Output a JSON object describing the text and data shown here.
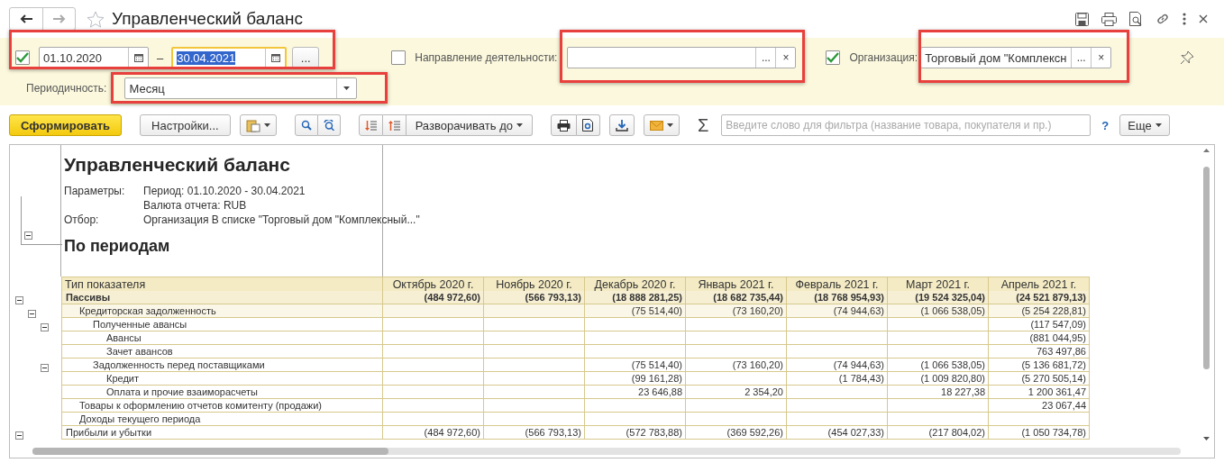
{
  "window": {
    "title": "Управленческий баланс"
  },
  "filters": {
    "period": {
      "checked": true,
      "from": {
        "value": "01.10.2020",
        "focused": false
      },
      "separator": "–",
      "to": {
        "value": "30.04.2021",
        "focused": true
      },
      "more_button": "..."
    },
    "direction": {
      "checked": false,
      "label": "Направление деятельности:",
      "more_button": "...",
      "clear_button": "×"
    },
    "organization": {
      "checked": true,
      "label": "Организация:",
      "value": "Торговый дом \"Комплексн",
      "more_button": "...",
      "clear_button": "×"
    },
    "periodicity": {
      "label": "Периодичность:",
      "value": "Месяц"
    }
  },
  "toolbar": {
    "generate_button": "Сформировать",
    "settings_button": "Настройки...",
    "expand_button": "Разворачивать до",
    "sum_sign": "Σ",
    "filter_placeholder": "Введите слово для фильтра (название товара, покупателя и пр.)",
    "help_link": "?",
    "more_button": "Еще"
  },
  "report": {
    "title": "Управленческий баланс",
    "params": [
      {
        "label": "Параметры:",
        "value": "Период: 01.10.2020 - 30.04.2021"
      },
      {
        "value": "Валюта отчета: RUB"
      },
      {
        "label": "Отбор:",
        "value": "Организация В списке \"Торговый дом \"Комплексный...\""
      }
    ],
    "subtitle": "По периодам",
    "table": {
      "columns": [
        "Тип показателя",
        "Октябрь 2020 г.",
        "Ноябрь 2020 г.",
        "Декабрь 2020 г.",
        "Январь 2021 г.",
        "Февраль 2021 г.",
        "Март 2021 г.",
        "Апрель 2021 г."
      ],
      "rows": [
        {
          "kind": "total",
          "label": "Пассивы",
          "expanded": true,
          "values": {
            "column_2": "(484 972,60)",
            "column_3": "(566 793,13)",
            "column_4": "(18 888 281,25)",
            "column_5": "(18 682 735,44)",
            "column_6": "(18 768 954,93)",
            "column_7": "(19 524 325,04)",
            "column_8": "(24 521 879,13)"
          },
          "children": [
            {
              "kind": "group",
              "label": "Кредиторская задолженность",
              "expanded": true,
              "values": {
                "column_4": "(75 514,40)",
                "column_5": "(73 160,20)",
                "column_6": "(74 944,63)",
                "column_7": "(1 066 538,05)",
                "column_8": "(5 254 228,81)"
              },
              "children": [
                {
                  "kind": "item",
                  "label": "Полученные авансы",
                  "expanded": true,
                  "values": {
                    "column_8": "(117 547,09)"
                  },
                  "children": [
                    {
                      "kind": "item",
                      "label": "Авансы",
                      "values": {
                        "column_8": "(881 044,95)"
                      }
                    },
                    {
                      "kind": "item",
                      "label": "Зачет авансов",
                      "values": {
                        "column_8": "763 497,86"
                      }
                    }
                  ]
                },
                {
                  "kind": "item",
                  "label": "Задолженность перед поставщиками",
                  "expanded": true,
                  "values": {
                    "column_4": "(75 514,40)",
                    "column_5": "(73 160,20)",
                    "column_6": "(74 944,63)",
                    "column_7": "(1 066 538,05)",
                    "column_8": "(5 136 681,72)"
                  },
                  "children": [
                    {
                      "kind": "item",
                      "label": "Кредит",
                      "values": {
                        "column_4": "(99 161,28)",
                        "column_6": "(1 784,43)",
                        "column_7": "(1 009 820,80)",
                        "column_8": "(5 270 505,14)"
                      }
                    },
                    {
                      "kind": "item",
                      "label": "Оплата и прочие взаиморасчеты",
                      "values": {
                        "column_4": "23 646,88",
                        "column_5": "2 354,20",
                        "column_7": "18 227,38",
                        "column_8": "1 200 361,47"
                      }
                    }
                  ]
                }
              ]
            },
            {
              "kind": "item",
              "label": "Товары к оформлению отчетов комитенту (продажи)",
              "values": {
                "column_8": "23 067,44"
              }
            },
            {
              "kind": "item",
              "label": "Доходы текущего периода"
            }
          ]
        },
        {
          "kind": "item",
          "label": "Прибыли и убытки",
          "expanded": true,
          "values": {
            "column_2": "(484 972,60)",
            "column_3": "(566 793,13)",
            "column_4": "(572 783,88)",
            "column_5": "(369 592,26)",
            "column_6": "(454 027,33)",
            "column_7": "(217 804,02)",
            "column_8": "(1 050 734,78)"
          }
        }
      ]
    }
  }
}
